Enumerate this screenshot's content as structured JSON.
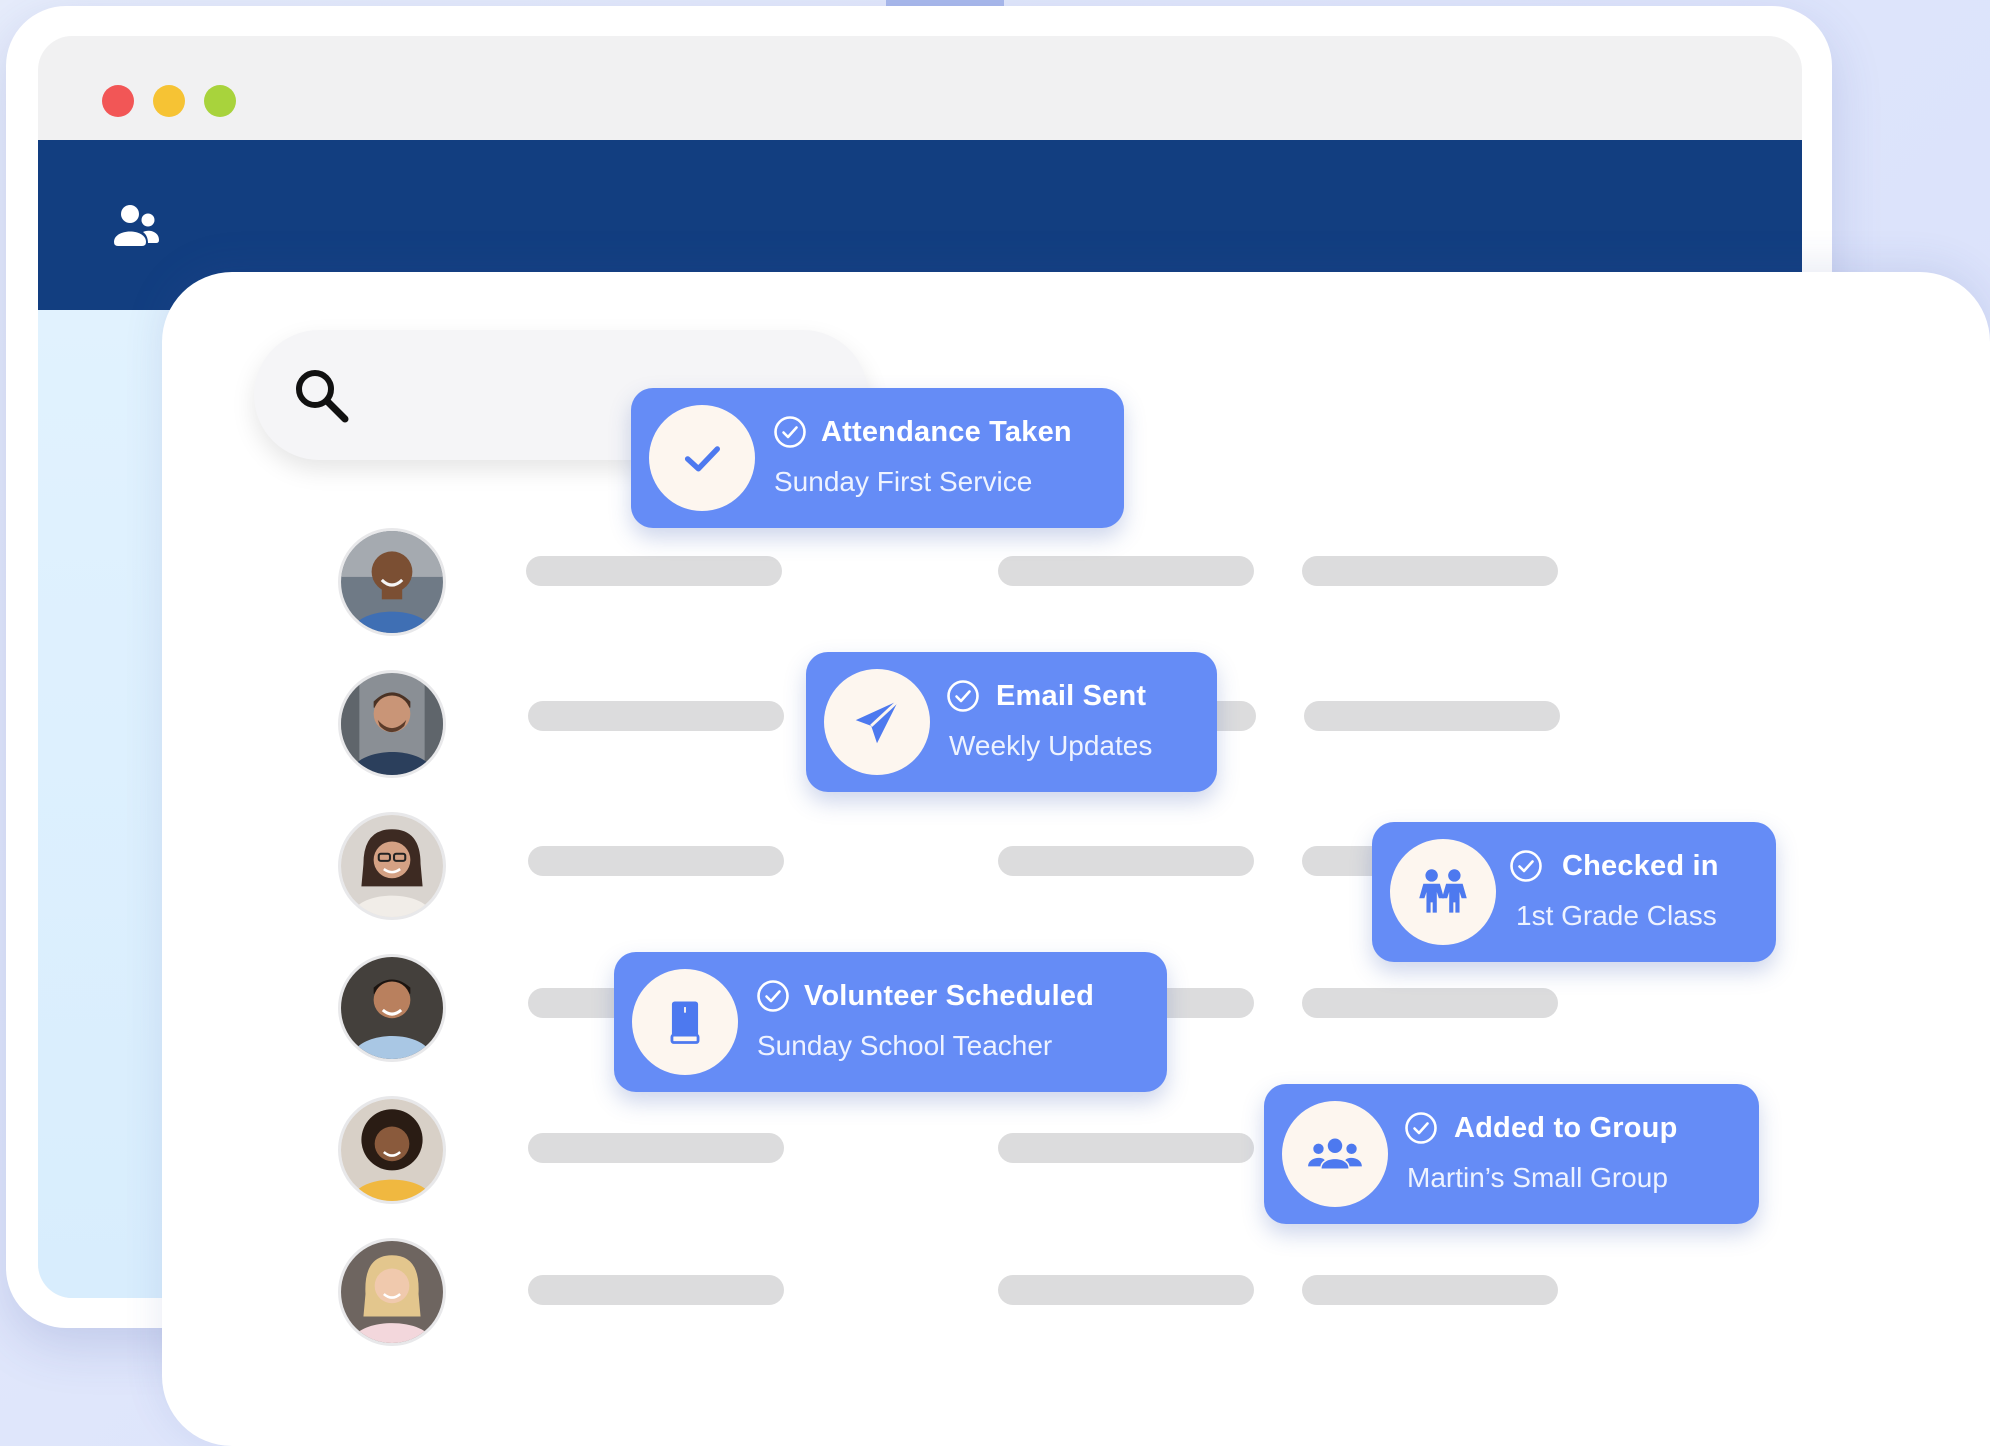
{
  "colors": {
    "navbar": "#123e80",
    "accent": "#658cf6",
    "placeholder_bar": "#dcdcdd",
    "window_red": "#f25656",
    "window_yellow": "#f6c334",
    "window_green": "#a8d33c"
  },
  "navbar": {
    "icon": "people-icon"
  },
  "search": {
    "icon": "search-icon"
  },
  "people": [
    {
      "avatar": "avatar-man-1"
    },
    {
      "avatar": "avatar-man-2"
    },
    {
      "avatar": "avatar-woman-1"
    },
    {
      "avatar": "avatar-man-3"
    },
    {
      "avatar": "avatar-woman-2"
    },
    {
      "avatar": "avatar-woman-3"
    }
  ],
  "notifications": [
    {
      "icon": "checkmark-icon",
      "title": "Attendance Taken",
      "subtitle": "Sunday First Service"
    },
    {
      "icon": "paper-plane-icon",
      "title": "Email Sent",
      "subtitle": "Weekly Updates"
    },
    {
      "icon": "children-icon",
      "title": "Checked in",
      "subtitle": "1st Grade Class"
    },
    {
      "icon": "book-icon",
      "title": "Volunteer Scheduled",
      "subtitle": "Sunday School Teacher"
    },
    {
      "icon": "group-icon",
      "title": "Added to Group",
      "subtitle": "Martin’s Small Group"
    }
  ]
}
